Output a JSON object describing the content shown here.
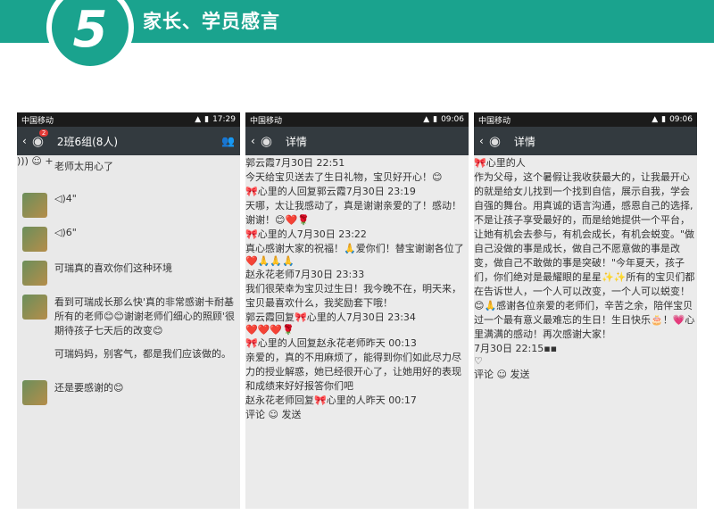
{
  "header": {
    "number": "5",
    "title": "家长、学员感言"
  },
  "phone1": {
    "status": {
      "carrier": "中国移动",
      "time": "17:29"
    },
    "title": {
      "back": "‹",
      "badge": "2",
      "name": "2班6组(8人)"
    },
    "messages": [
      {
        "type": "text",
        "text": "老师太用心了"
      },
      {
        "type": "voice",
        "length": "4\""
      },
      {
        "type": "voice",
        "length": "6\""
      },
      {
        "type": "text",
        "text": "可瑞真的喜欢你们这种环境"
      },
      {
        "type": "text",
        "text": "看到可瑞成长那么快'真的非常感谢卡耐基所有的老师😊😊谢谢老师们细心的照顾'很期待孩子七天后的改变😊"
      },
      {
        "type": "text",
        "text": "可瑞妈妈，别客气，都是我们应该做的。"
      },
      {
        "type": "text",
        "text": "还是要感谢的😊"
      }
    ]
  },
  "phone2": {
    "status": {
      "carrier": "中国移动",
      "time": "09:06"
    },
    "title": {
      "back": "‹",
      "name": "详情"
    },
    "posts": [
      {
        "author": "郭云霞",
        "time": "7月30日 22:51",
        "text": "今天给宝贝送去了生日礼物，宝贝好开心！😊"
      },
      {
        "author": "🎀心里的人回复郭云霞",
        "time": "7月30日 23:19",
        "text": "天哪，太让我感动了，真是谢谢亲爱的了！感动！谢谢！😊❤️🌹"
      },
      {
        "author": "🎀心里的人",
        "time": "7月30日 23:22",
        "text": "真心感谢大家的祝福！🙏爱你们！替宝谢谢各位了❤️🙏🙏🙏"
      },
      {
        "author": "赵永花老师",
        "time": "7月30日 23:33",
        "text": "我们很荣幸为宝贝过生日！我今晚不在，明天来，宝贝最喜欢什么，我奖励套下哦！"
      },
      {
        "author": "郭云霞回复🎀心里的人",
        "time": "7月30日 23:34",
        "text": "❤️❤️❤️🌹"
      },
      {
        "author": "🎀心里的人回复赵永花老师",
        "time": "昨天 00:13",
        "text": "亲爱的，真的不用麻烦了，能得到你们如此尽力尽力的授业解惑，她已经很开心了，让她用好的表现和成绩来好好报答你们吧"
      },
      {
        "author": "赵永花老师回复🎀心里的人",
        "time": "昨天 00:17",
        "text": ""
      }
    ],
    "comment_placeholder": "评论",
    "send": "发送"
  },
  "phone3": {
    "status": {
      "carrier": "中国移动",
      "time": "09:06"
    },
    "title": {
      "back": "‹",
      "name": "详情"
    },
    "post": {
      "author": "🎀心里的人",
      "text": "作为父母，这个暑假让我收获最大的，让我最开心的就是给女儿找到一个找到自信，展示自我，学会自强的舞台。用真诚的语言沟通，感恩自己的选择,不是让孩子享受最好的，而是给她提供一个平台，让她有机会去参与，有机会成长，有机会蜕变。\"做自己没做的事是成长，做自己不愿意做的事是改变，做自己不敢做的事是突破！\"今年夏天，孩子们，你们绝对是最耀眼的星星✨✨所有的宝贝们都在告诉世人，一个人可以改变，一个人可以蜕变！😊🙏感谢各位亲爱的老师们，辛苦之余，陪伴宝贝过一个最有意义最难忘的生日！生日快乐🎂！💗心里满满的感动！再次感谢大家！",
      "time": "7月30日 22:15"
    },
    "comment_placeholder": "评论",
    "send": "发送"
  }
}
